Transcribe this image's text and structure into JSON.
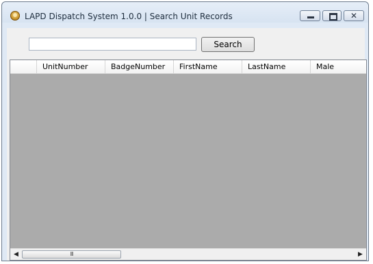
{
  "window": {
    "title": "LAPD Dispatch System 1.0.0 | Search Unit Records",
    "icon": "badge-icon",
    "controls": {
      "minimize": "minimize-icon",
      "maximize": "maximize-icon",
      "close_glyph": "✕"
    }
  },
  "search": {
    "value": "",
    "placeholder": "",
    "button_label": "Search"
  },
  "grid": {
    "columns": [
      "UnitNumber",
      "BadgeNumber",
      "FirstName",
      "LastName",
      "Male"
    ],
    "rows": [],
    "background_color": "#ababab"
  },
  "scrollbar": {
    "left_arrow": "◀",
    "right_arrow": "▶",
    "thumb_grip": "III"
  }
}
